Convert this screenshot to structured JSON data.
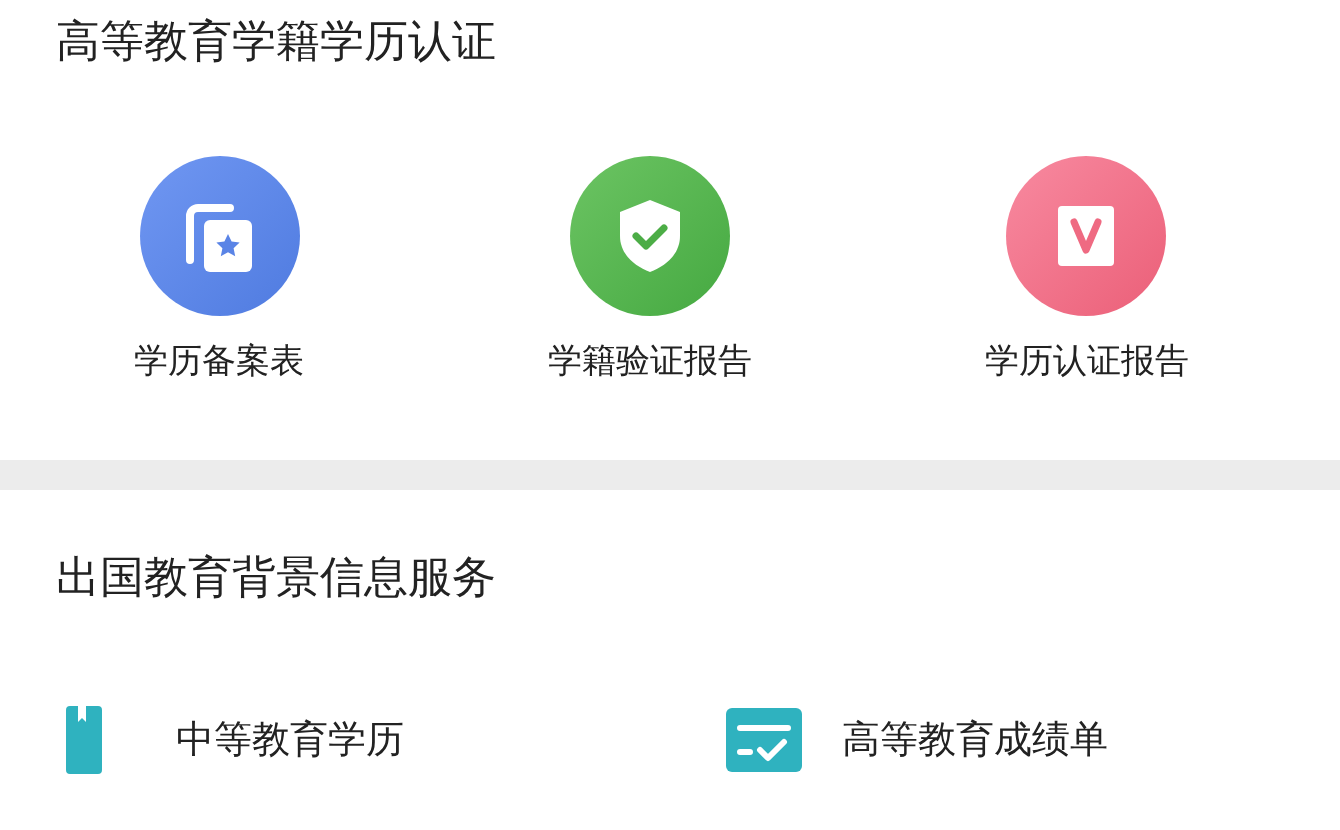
{
  "sections": [
    {
      "title": "高等教育学籍学历认证",
      "kind": "grid",
      "items": [
        {
          "label": "学历备案表",
          "kind": "record"
        },
        {
          "label": "学籍验证报告",
          "kind": "shield"
        },
        {
          "label": "学历认证报告",
          "kind": "v-card"
        }
      ]
    },
    {
      "title": "出国教育背景信息服务",
      "kind": "list",
      "items": [
        {
          "label": "中等教育学历",
          "kind": "book"
        },
        {
          "label": "高等教育成绩单",
          "kind": "transcript"
        }
      ]
    }
  ]
}
